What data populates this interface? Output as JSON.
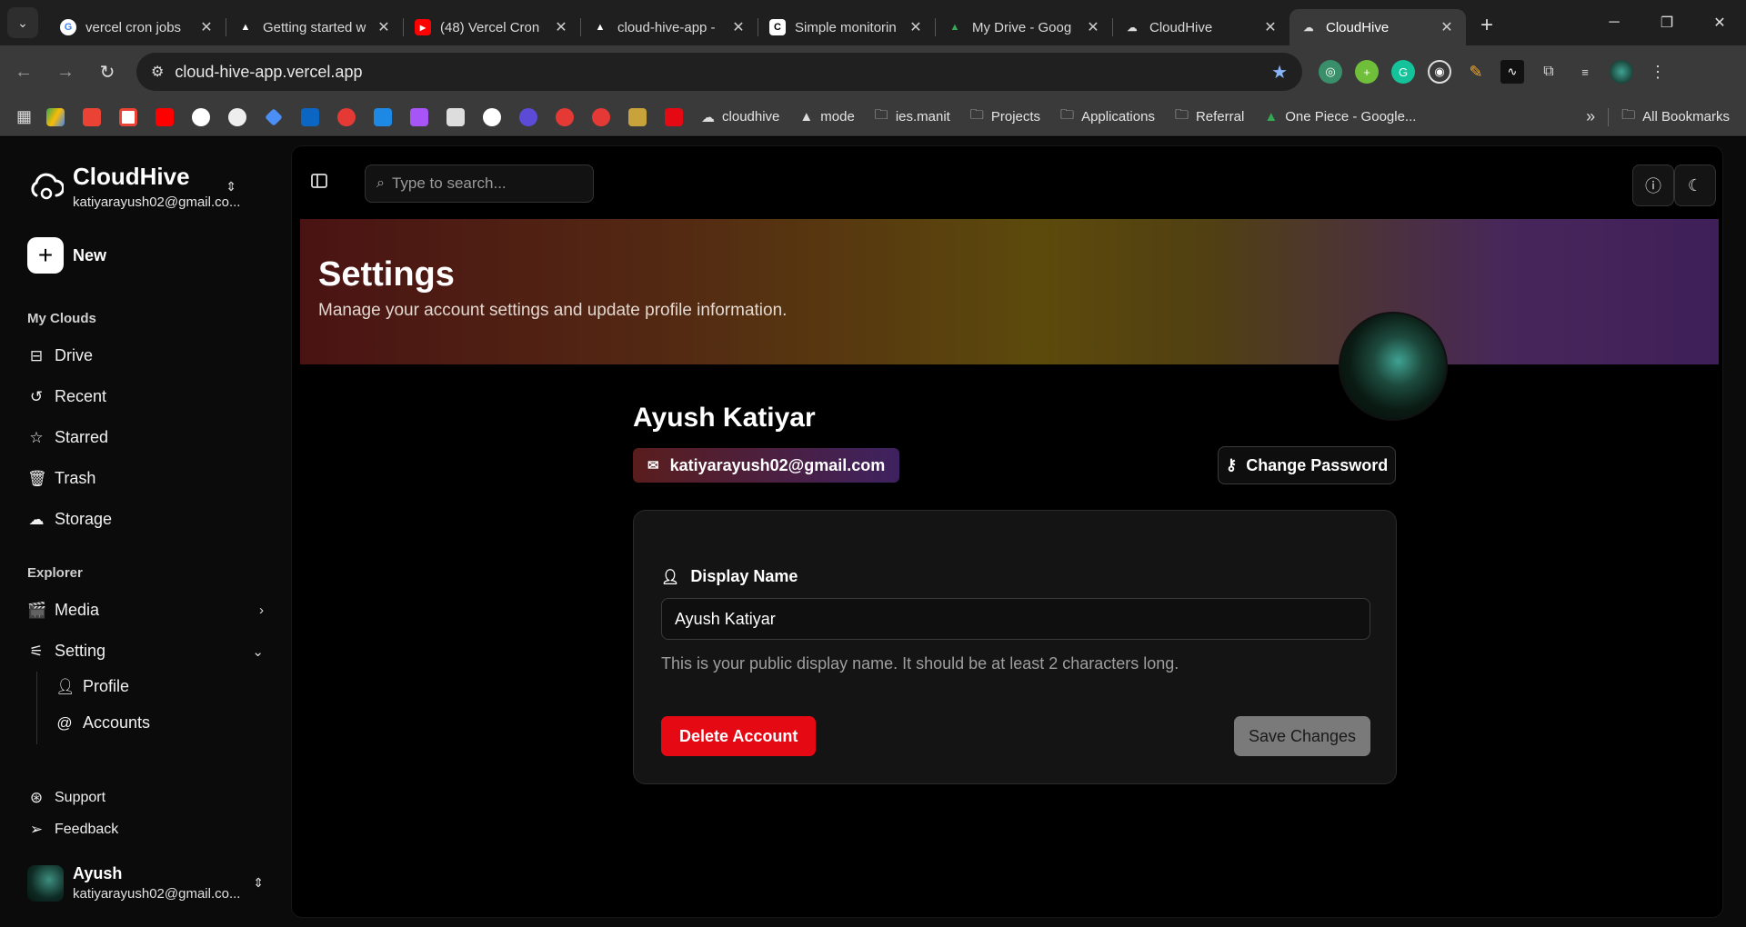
{
  "browser": {
    "tabs": [
      {
        "title": "vercel cron jobs",
        "icon": "google-icon",
        "color": "#4285f4"
      },
      {
        "title": "Getting started w",
        "icon": "vercel-icon",
        "color": "#ffffff"
      },
      {
        "title": "(48) Vercel Cron",
        "icon": "youtube-icon",
        "color": "#ff0000"
      },
      {
        "title": "cloud-hive-app -",
        "icon": "vercel-icon",
        "color": "#ffffff"
      },
      {
        "title": "Simple monitorin",
        "icon": "cronitor-icon",
        "color": "#ffffff"
      },
      {
        "title": "My Drive - Goog",
        "icon": "google-drive-icon",
        "color": "#34a853"
      },
      {
        "title": "CloudHive",
        "icon": "cloud-icon",
        "color": "#dddddd"
      },
      {
        "title": "CloudHive",
        "icon": "cloud-icon",
        "color": "#dddddd"
      }
    ],
    "url": "cloud-hive-app.vercel.app",
    "bookmarks": [
      {
        "label": "cloudhive",
        "icon": "cloud-icon"
      },
      {
        "label": "mode",
        "icon": "vercel-icon"
      },
      {
        "label": "ies.manit",
        "icon": "folder-icon"
      },
      {
        "label": "Projects",
        "icon": "folder-icon"
      },
      {
        "label": "Applications",
        "icon": "folder-icon"
      },
      {
        "label": "Referral",
        "icon": "folder-icon"
      },
      {
        "label": "One Piece - Google...",
        "icon": "google-drive-icon"
      }
    ],
    "all_bookmarks": "All Bookmarks"
  },
  "sidebar": {
    "app_name": "CloudHive",
    "account_email": "katiyarayush02@gmail.co...",
    "new_label": "New",
    "section_my_clouds": "My Clouds",
    "my_clouds": [
      {
        "label": "Drive",
        "icon": "drive-icon"
      },
      {
        "label": "Recent",
        "icon": "history-icon"
      },
      {
        "label": "Starred",
        "icon": "star-icon"
      },
      {
        "label": "Trash",
        "icon": "trash-icon"
      },
      {
        "label": "Storage",
        "icon": "storage-icon"
      }
    ],
    "section_explorer": "Explorer",
    "media": "Media",
    "setting": "Setting",
    "setting_sub": [
      {
        "label": "Profile",
        "icon": "user-icon"
      },
      {
        "label": "Accounts",
        "icon": "at-sign-icon"
      }
    ],
    "support": "Support",
    "feedback": "Feedback",
    "user_name": "Ayush",
    "user_email": "katiyarayush02@gmail.co..."
  },
  "search": {
    "placeholder": "Type to search..."
  },
  "hero": {
    "title": "Settings",
    "subtitle": "Manage your account settings and update profile information."
  },
  "profile": {
    "name": "Ayush Katiyar",
    "email": "katiyarayush02@gmail.com",
    "change_password": "Change Password",
    "display_name_label": "Display Name",
    "display_name_value": "Ayush Katiyar",
    "help_text": "This is your public display name. It should be at least 2 characters long.",
    "delete_label": "Delete Account",
    "save_label": "Save Changes"
  },
  "colors": {
    "accent_danger": "#e50914",
    "disabled_button": "#7a7a7a",
    "bookmark_star": "#8ab4f8"
  }
}
